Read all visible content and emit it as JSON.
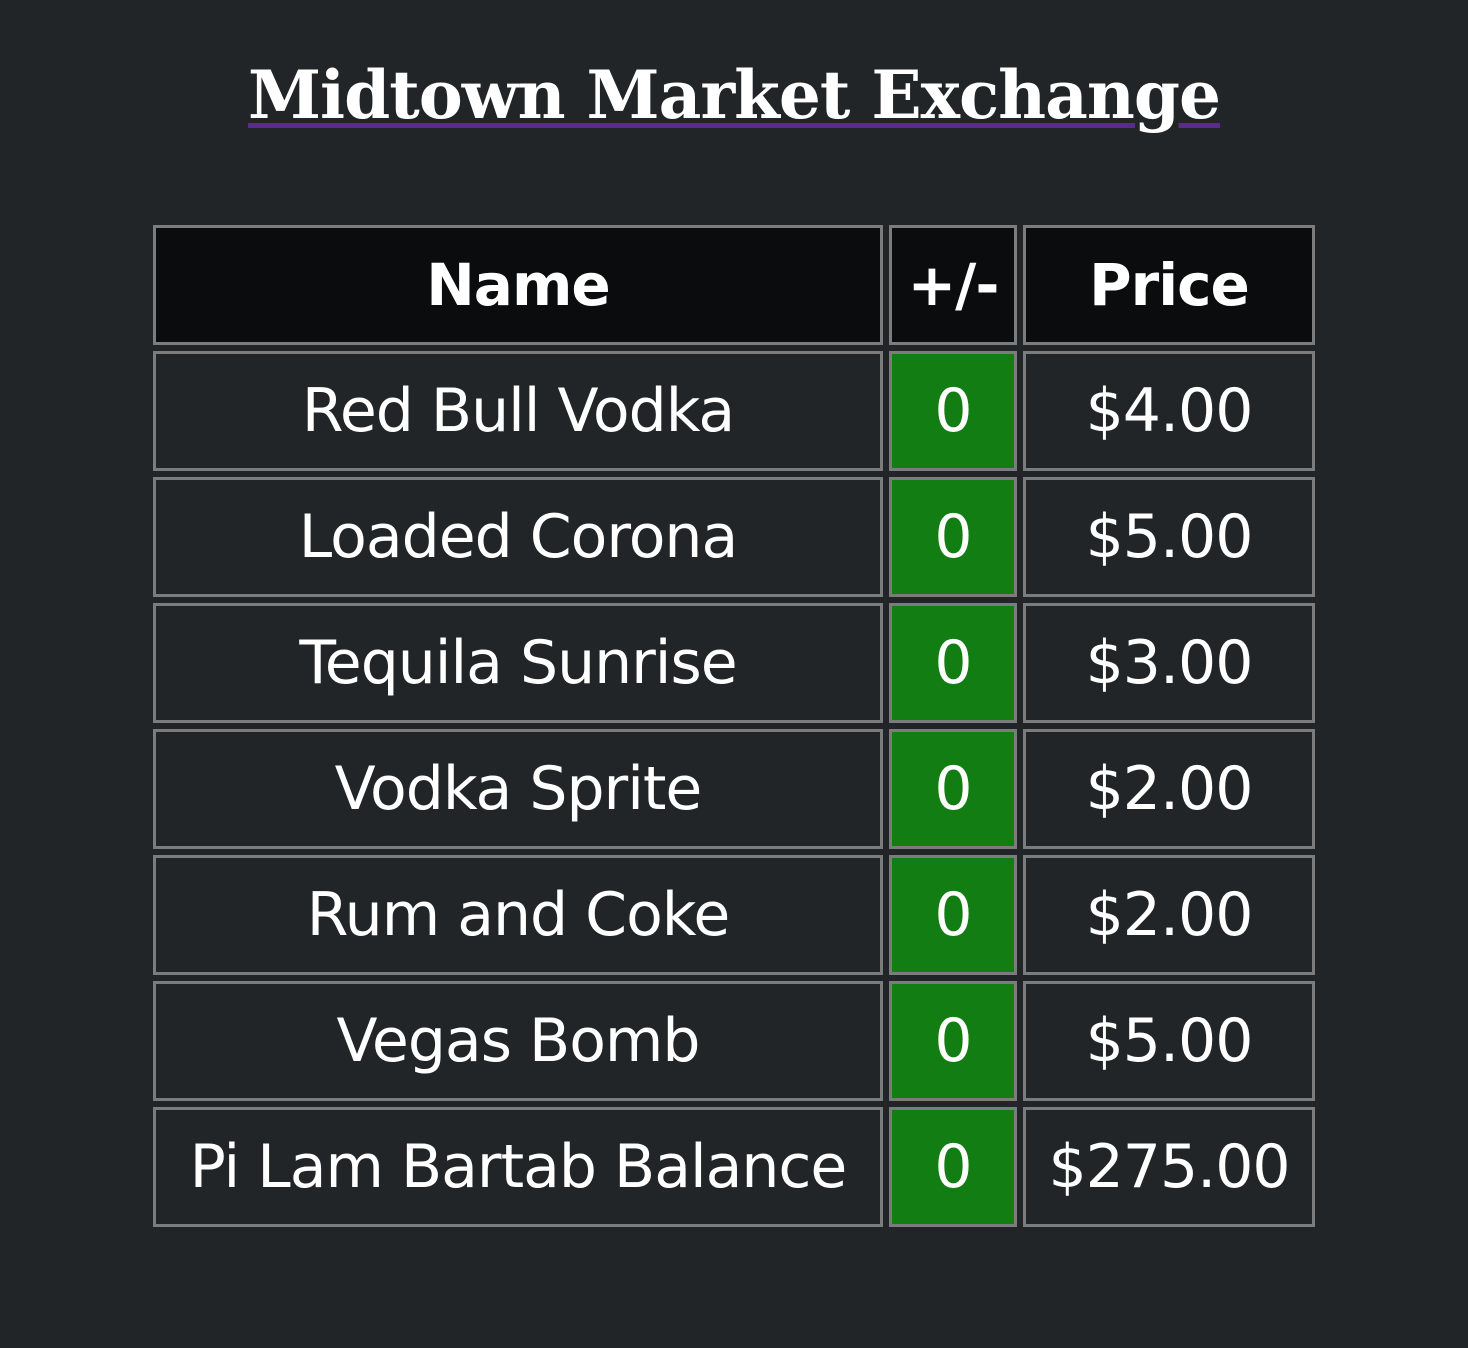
{
  "title": "Midtown Market Exchange",
  "table": {
    "headers": {
      "name": "Name",
      "delta": "+/-",
      "price": "Price"
    },
    "rows": [
      {
        "name": "Red Bull Vodka",
        "delta": "0",
        "price": "$4.00"
      },
      {
        "name": "Loaded Corona",
        "delta": "0",
        "price": "$5.00"
      },
      {
        "name": "Tequila Sunrise",
        "delta": "0",
        "price": "$3.00"
      },
      {
        "name": "Vodka Sprite",
        "delta": "0",
        "price": "$2.00"
      },
      {
        "name": "Rum and Coke",
        "delta": "0",
        "price": "$2.00"
      },
      {
        "name": "Vegas Bomb",
        "delta": "0",
        "price": "$5.00"
      },
      {
        "name": "Pi Lam Bartab Balance",
        "delta": "0",
        "price": "$275.00"
      }
    ]
  },
  "colors": {
    "background": "#222528",
    "header_background": "#0b0c0d",
    "delta_positive": "#117d12",
    "title_underline": "#5b2a91",
    "cell_border": "#7c7c7c"
  }
}
